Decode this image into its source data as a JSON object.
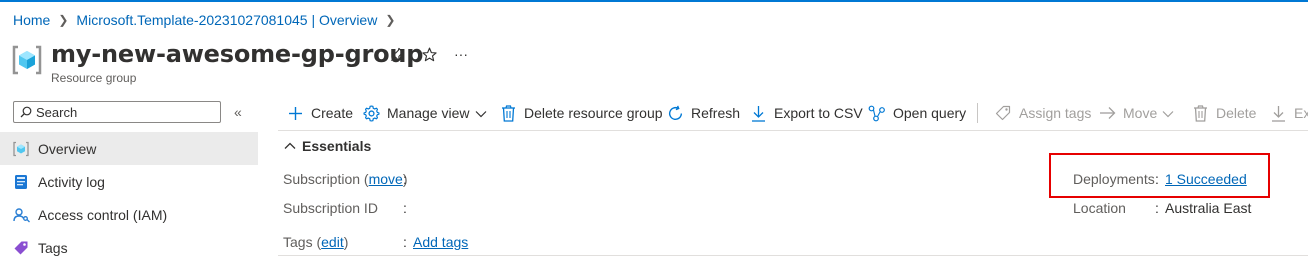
{
  "breadcrumb": {
    "home": "Home",
    "deployment": "Microsoft.Template-20231027081045 | Overview"
  },
  "header": {
    "title": "my-new-awesome-gp-group",
    "subtitle": "Resource group",
    "more": "···"
  },
  "sidebar": {
    "search_placeholder": "Search",
    "collapse": "«",
    "items": [
      {
        "label": "Overview",
        "icon": "resource-group-icon",
        "selected": true
      },
      {
        "label": "Activity log",
        "icon": "activity-log-icon"
      },
      {
        "label": "Access control (IAM)",
        "icon": "iam-icon"
      },
      {
        "label": "Tags",
        "icon": "tag-icon"
      }
    ]
  },
  "toolbar": {
    "create": "Create",
    "manage_view": "Manage view",
    "delete_rg": "Delete resource group",
    "refresh": "Refresh",
    "export_csv": "Export to CSV",
    "open_query": "Open query",
    "assign_tags": "Assign tags",
    "move": "Move",
    "delete": "Delete",
    "export_truncated": "Exp"
  },
  "essentials": {
    "heading": "Essentials",
    "subscription_label": "Subscription",
    "subscription_move": "move",
    "subscription_id_label": "Subscription ID",
    "tags_label": "Tags",
    "tags_edit": "edit",
    "add_tags": "Add tags",
    "deployments_label": "Deployments",
    "deployments_value": "1 Succeeded",
    "location_label": "Location",
    "location_value": "Australia East"
  },
  "colors": {
    "accent": "#0078d4",
    "link": "#0067b8",
    "highlight_border": "#e60000",
    "selected_bg": "#ebebeb"
  }
}
